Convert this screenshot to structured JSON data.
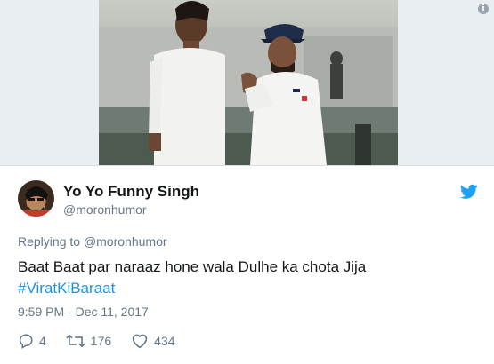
{
  "tweet": {
    "display_name": "Yo Yo Funny Singh",
    "handle": "@moronhumor",
    "replying_prefix": "Replying to",
    "replying_to": "@moronhumor",
    "text_line1": "Baat Baat par naraaz hone wala Dulhe ka chota Jija",
    "hashtag": "#ViratKiBaraat",
    "timestamp": "9:59 PM - Dec 11, 2017",
    "reply_count": "4",
    "retweet_count": "176",
    "like_count": "434"
  },
  "icons": {
    "info": "info-icon",
    "brand": "twitter-bird-icon",
    "reply": "reply-icon",
    "retweet": "retweet-icon",
    "like": "heart-icon"
  },
  "colors": {
    "link": "#1b95e0",
    "secondary_text": "#657786",
    "primary_text": "#14171a"
  }
}
